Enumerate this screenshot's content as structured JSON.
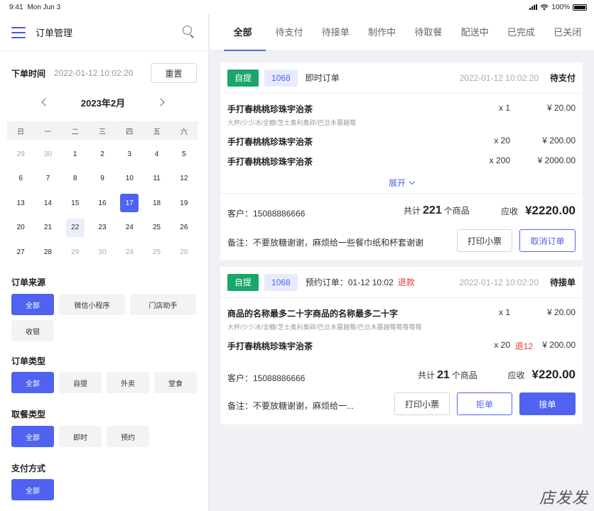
{
  "status_bar": {
    "time": "9:41",
    "date": "Mon Jun 3",
    "battery": "100%"
  },
  "left": {
    "title": "订单管理",
    "order_time_label": "下单时间",
    "order_time_value": "2022-01-12  10:02:20",
    "reset_label": "重置",
    "calendar": {
      "month": "2023年2月",
      "weekdays": [
        "日",
        "一",
        "二",
        "三",
        "四",
        "五",
        "六"
      ],
      "weeks": [
        [
          "29",
          "30",
          "1",
          "2",
          "3",
          "4",
          "5"
        ],
        [
          "6",
          "7",
          "8",
          "9",
          "10",
          "11",
          "12"
        ],
        [
          "13",
          "14",
          "15",
          "16",
          "17",
          "18",
          "19"
        ],
        [
          "20",
          "21",
          "22",
          "23",
          "24",
          "25",
          "26"
        ],
        [
          "27",
          "28",
          "29",
          "30",
          "24",
          "25",
          "26"
        ]
      ],
      "selected": "17",
      "highlighted": "22"
    },
    "source": {
      "title": "订单来源",
      "options": [
        "全部",
        "微信小程序",
        "门店助手",
        "收银"
      ],
      "active": "全部"
    },
    "type": {
      "title": "订单类型",
      "options": [
        "全部",
        "自提",
        "外卖",
        "堂食"
      ],
      "active": "全部"
    },
    "pickup": {
      "title": "取餐类型",
      "options": [
        "全部",
        "即时",
        "预约"
      ],
      "active": "全部"
    },
    "payment": {
      "title": "支付方式",
      "options": [
        "全部"
      ],
      "active": "全部"
    }
  },
  "tabs": {
    "items": [
      "全部",
      "待支付",
      "待接单",
      "制作中",
      "待取餐",
      "配送中",
      "已完成",
      "已关闭"
    ],
    "active": "全部"
  },
  "orders": [
    {
      "tag": "自提",
      "number": "1068",
      "kind": "即时订单",
      "refund": "",
      "time": "2022-01-12  10:02:20",
      "status": "待支付",
      "items": [
        {
          "name": "手打春桃桃珍珠宇治茶",
          "spec": "大杯/少少冰/全糖/芝士奥利奥碎/巴旦木蔓越莓",
          "qty": "x 1",
          "back": "",
          "price": "¥ 20.00"
        },
        {
          "name": "手打春桃桃珍珠宇治茶",
          "spec": "",
          "qty": "x 20",
          "back": "",
          "price": "¥ 200.00"
        },
        {
          "name": "手打春桃桃珍珠宇治茶",
          "spec": "",
          "qty": "x 200",
          "back": "",
          "price": "¥ 2000.00"
        }
      ],
      "expand_label": "展开",
      "customer": "客户：15088886666",
      "total_prefix": "共计",
      "total_count": "221",
      "total_suffix": "个商品",
      "due_label": "应收",
      "due_amount": "¥2220.00",
      "note": "备注：不要放糖谢谢，麻烦给一些餐巾纸和杯套谢谢",
      "buttons": [
        "打印小票",
        "取消订单"
      ]
    },
    {
      "tag": "自提",
      "number": "1068",
      "kind": "预约订单：01-12  10:02",
      "refund": "退款",
      "time": "2022-01-12  10:02:20",
      "status": "待接单",
      "items": [
        {
          "name": "商品的名称最多二十字商品的名称最多二十字",
          "spec": "大杯/少少冰/全糖/芝士奥利奥碎/巴旦木蔓越莓/巴旦木蔓越莓莓莓莓莓",
          "qty": "x 1",
          "back": "",
          "price": "¥ 20.00"
        },
        {
          "name": "手打春桃桃珍珠宇治茶",
          "spec": "",
          "qty": "x 20",
          "back": "退12",
          "price": "¥ 200.00"
        }
      ],
      "customer": "客户：15088886666",
      "total_prefix": "共计",
      "total_count": "21",
      "total_suffix": "个商品",
      "due_label": "应收",
      "due_amount": "¥220.00",
      "note": "备注：不要放糖谢谢，麻烦给一...",
      "buttons": [
        "打印小票",
        "拒单",
        "接单"
      ]
    }
  ],
  "watermark": "店发发"
}
